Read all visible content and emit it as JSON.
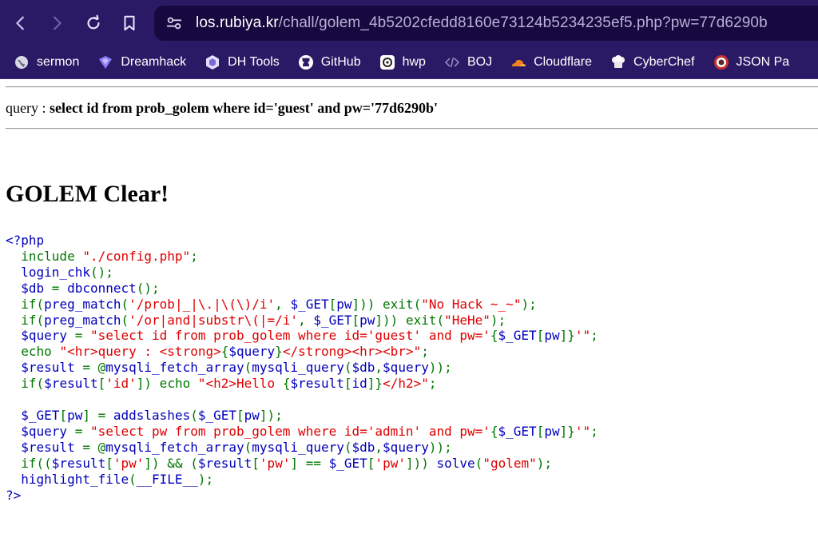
{
  "browser": {
    "url_host": "los.rubiya.kr",
    "url_path": "/chall/golem_4b5202cfedd8160e73124b5234235ef5.php?pw=77d6290b"
  },
  "bookmarks": [
    {
      "label": "sermon",
      "icon": "globe-icon"
    },
    {
      "label": "Dreamhack",
      "icon": "dreamhack-icon"
    },
    {
      "label": "DH Tools",
      "icon": "hexagon-icon"
    },
    {
      "label": "GitHub",
      "icon": "github-icon"
    },
    {
      "label": "hwp",
      "icon": "hwp-icon"
    },
    {
      "label": "BOJ",
      "icon": "code-bracket-icon"
    },
    {
      "label": "Cloudflare",
      "icon": "cloud-icon"
    },
    {
      "label": "CyberChef",
      "icon": "chef-hat-icon"
    },
    {
      "label": "JSON Pa",
      "icon": "json-icon"
    }
  ],
  "page": {
    "query_prefix": "query : ",
    "query_sql": "select id from prob_golem where id='guest' and pw='77d6290b'",
    "heading": "GOLEM Clear!"
  },
  "code_lines": [
    [
      [
        "d",
        "<?php"
      ]
    ],
    [
      [
        "k",
        "  include "
      ],
      [
        "s",
        "\"./config.php\""
      ],
      [
        "k",
        ";"
      ]
    ],
    [
      [
        "k",
        "  "
      ],
      [
        "d",
        "login_chk"
      ],
      [
        "k",
        "();"
      ]
    ],
    [
      [
        "k",
        "  "
      ],
      [
        "d",
        "$db "
      ],
      [
        "k",
        "= "
      ],
      [
        "d",
        "dbconnect"
      ],
      [
        "k",
        "();"
      ]
    ],
    [
      [
        "k",
        "  if("
      ],
      [
        "d",
        "preg_match"
      ],
      [
        "k",
        "("
      ],
      [
        "s",
        "'/prob|_|\\.|\\(\\)/i'"
      ],
      [
        "k",
        ", "
      ],
      [
        "d",
        "$_GET"
      ],
      [
        "k",
        "["
      ],
      [
        "d",
        "pw"
      ],
      [
        "k",
        "])) exit("
      ],
      [
        "s",
        "\"No Hack ~_~\""
      ],
      [
        "k",
        ");"
      ]
    ],
    [
      [
        "k",
        "  if("
      ],
      [
        "d",
        "preg_match"
      ],
      [
        "k",
        "("
      ],
      [
        "s",
        "'/or|and|substr\\(|=/i'"
      ],
      [
        "k",
        ", "
      ],
      [
        "d",
        "$_GET"
      ],
      [
        "k",
        "["
      ],
      [
        "d",
        "pw"
      ],
      [
        "k",
        "])) exit("
      ],
      [
        "s",
        "\"HeHe\""
      ],
      [
        "k",
        ");"
      ]
    ],
    [
      [
        "k",
        "  "
      ],
      [
        "d",
        "$query "
      ],
      [
        "k",
        "= "
      ],
      [
        "s",
        "\"select id from prob_golem where id='guest' and pw='"
      ],
      [
        "k",
        "{"
      ],
      [
        "d",
        "$_GET"
      ],
      [
        "k",
        "["
      ],
      [
        "d",
        "pw"
      ],
      [
        "k",
        "]}"
      ],
      [
        "s",
        "'\""
      ],
      [
        "k",
        ";"
      ]
    ],
    [
      [
        "k",
        "  echo "
      ],
      [
        "s",
        "\"<hr>query : <strong>"
      ],
      [
        "k",
        "{"
      ],
      [
        "d",
        "$query"
      ],
      [
        "k",
        "}"
      ],
      [
        "s",
        "</strong><hr><br>\""
      ],
      [
        "k",
        ";"
      ]
    ],
    [
      [
        "k",
        "  "
      ],
      [
        "d",
        "$result "
      ],
      [
        "k",
        "= @"
      ],
      [
        "d",
        "mysqli_fetch_array"
      ],
      [
        "k",
        "("
      ],
      [
        "d",
        "mysqli_query"
      ],
      [
        "k",
        "("
      ],
      [
        "d",
        "$db"
      ],
      [
        "k",
        ","
      ],
      [
        "d",
        "$query"
      ],
      [
        "k",
        "));"
      ]
    ],
    [
      [
        "k",
        "  if("
      ],
      [
        "d",
        "$result"
      ],
      [
        "k",
        "["
      ],
      [
        "s",
        "'id'"
      ],
      [
        "k",
        "]) echo "
      ],
      [
        "s",
        "\"<h2>Hello "
      ],
      [
        "k",
        "{"
      ],
      [
        "d",
        "$result"
      ],
      [
        "k",
        "["
      ],
      [
        "d",
        "id"
      ],
      [
        "k",
        "]}"
      ],
      [
        "s",
        "</h2>\""
      ],
      [
        "k",
        ";"
      ]
    ],
    [
      [
        "k",
        " "
      ]
    ],
    [
      [
        "k",
        "  "
      ],
      [
        "d",
        "$_GET"
      ],
      [
        "k",
        "["
      ],
      [
        "d",
        "pw"
      ],
      [
        "k",
        "] = "
      ],
      [
        "d",
        "addslashes"
      ],
      [
        "k",
        "("
      ],
      [
        "d",
        "$_GET"
      ],
      [
        "k",
        "["
      ],
      [
        "d",
        "pw"
      ],
      [
        "k",
        "]);"
      ]
    ],
    [
      [
        "k",
        "  "
      ],
      [
        "d",
        "$query "
      ],
      [
        "k",
        "= "
      ],
      [
        "s",
        "\"select pw from prob_golem where id='admin' and pw='"
      ],
      [
        "k",
        "{"
      ],
      [
        "d",
        "$_GET"
      ],
      [
        "k",
        "["
      ],
      [
        "d",
        "pw"
      ],
      [
        "k",
        "]}"
      ],
      [
        "s",
        "'\""
      ],
      [
        "k",
        ";"
      ]
    ],
    [
      [
        "k",
        "  "
      ],
      [
        "d",
        "$result "
      ],
      [
        "k",
        "= @"
      ],
      [
        "d",
        "mysqli_fetch_array"
      ],
      [
        "k",
        "("
      ],
      [
        "d",
        "mysqli_query"
      ],
      [
        "k",
        "("
      ],
      [
        "d",
        "$db"
      ],
      [
        "k",
        ","
      ],
      [
        "d",
        "$query"
      ],
      [
        "k",
        "));"
      ]
    ],
    [
      [
        "k",
        "  if(("
      ],
      [
        "d",
        "$result"
      ],
      [
        "k",
        "["
      ],
      [
        "s",
        "'pw'"
      ],
      [
        "k",
        "]) && ("
      ],
      [
        "d",
        "$result"
      ],
      [
        "k",
        "["
      ],
      [
        "s",
        "'pw'"
      ],
      [
        "k",
        "] == "
      ],
      [
        "d",
        "$_GET"
      ],
      [
        "k",
        "["
      ],
      [
        "s",
        "'pw'"
      ],
      [
        "k",
        "])) "
      ],
      [
        "d",
        "solve"
      ],
      [
        "k",
        "("
      ],
      [
        "s",
        "\"golem\""
      ],
      [
        "k",
        ");"
      ]
    ],
    [
      [
        "k",
        "  "
      ],
      [
        "d",
        "highlight_file"
      ],
      [
        "k",
        "("
      ],
      [
        "d",
        "__FILE__"
      ],
      [
        "k",
        ");"
      ]
    ],
    [
      [
        "d",
        "?>"
      ]
    ]
  ]
}
